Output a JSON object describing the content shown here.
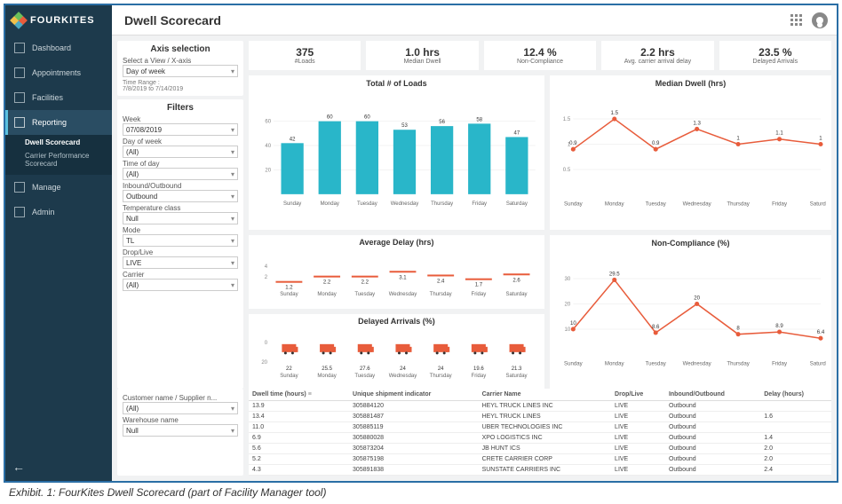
{
  "brand": "FOURKITES",
  "page_title": "Dwell Scorecard",
  "exhibit_caption": "Exhibit. 1: FourKites Dwell Scorecard (part of Facility Manager tool)",
  "sidebar": {
    "items": [
      {
        "label": "Dashboard",
        "active": false
      },
      {
        "label": "Appointments",
        "active": false
      },
      {
        "label": "Facilities",
        "active": false
      },
      {
        "label": "Reporting",
        "active": true
      },
      {
        "label": "Manage",
        "active": false
      },
      {
        "label": "Admin",
        "active": false
      }
    ],
    "sub_items": [
      {
        "label": "Dwell Scorecard",
        "selected": true
      },
      {
        "label": "Carrier Performance Scorecard",
        "selected": false
      }
    ],
    "collapse_icon": "←"
  },
  "axis": {
    "title": "Axis selection",
    "view_label": "Select a View / X-axis",
    "view_value": "Day of week",
    "time_range_label": "Time Range :",
    "time_range_value": "7/8/2019 to 7/14/2019"
  },
  "filters": {
    "title": "Filters",
    "fields": [
      {
        "label": "Week",
        "value": "07/08/2019"
      },
      {
        "label": "Day of week",
        "value": "(All)"
      },
      {
        "label": "Time of day",
        "value": "(All)"
      },
      {
        "label": "Inbound/Outbound",
        "value": "Outbound"
      },
      {
        "label": "Temperature class",
        "value": "Null"
      },
      {
        "label": "Mode",
        "value": "TL"
      },
      {
        "label": "Drop/Live",
        "value": "LIVE"
      },
      {
        "label": "Carrier",
        "value": "(All)"
      }
    ]
  },
  "table_filters": [
    {
      "label": "Customer name / Supplier n...",
      "value": "(All)"
    },
    {
      "label": "Warehouse name",
      "value": "Null"
    }
  ],
  "kpis": [
    {
      "value": "375",
      "label": "#Loads"
    },
    {
      "value": "1.0 hrs",
      "label": "Median Dwell"
    },
    {
      "value": "12.4 %",
      "label": "Non-Compliance"
    },
    {
      "value": "2.2 hrs",
      "label": "Avg. carrier arrival delay"
    },
    {
      "value": "23.5 %",
      "label": "Delayed Arrivals"
    }
  ],
  "chart_data": [
    {
      "id": "loads",
      "type": "bar",
      "title": "Total # of Loads",
      "categories": [
        "Sunday",
        "Monday",
        "Tuesday",
        "Wednesday",
        "Thursday",
        "Friday",
        "Saturday"
      ],
      "values": [
        42,
        60,
        60,
        53,
        56,
        58,
        47
      ],
      "ylim": [
        0,
        60
      ],
      "yticks": [
        20,
        40,
        60
      ],
      "color": "#29b6c9"
    },
    {
      "id": "median_dwell",
      "type": "line",
      "title": "Median Dwell (hrs)",
      "categories": [
        "Sunday",
        "Monday",
        "Tuesday",
        "Wednesday",
        "Thursday",
        "Friday",
        "Saturday"
      ],
      "values": [
        0.9,
        1.5,
        0.9,
        1.3,
        1.0,
        1.1,
        1.0
      ],
      "ylim": [
        0,
        1.5
      ],
      "yticks": [
        0.5,
        1.0,
        1.5
      ],
      "color": "#e85c3b"
    },
    {
      "id": "avg_delay",
      "type": "bar-thin",
      "title": "Average Delay (hrs)",
      "categories": [
        "Sunday",
        "Monday",
        "Tuesday",
        "Wednesday",
        "Thursday",
        "Friday",
        "Saturday"
      ],
      "values": [
        1.2,
        2.2,
        2.2,
        3.1,
        2.4,
        1.7,
        2.6
      ],
      "ylim": [
        0,
        4
      ],
      "yticks": [
        2,
        4
      ],
      "color": "#e85c3b"
    },
    {
      "id": "delayed_arrivals",
      "type": "icon-bar",
      "title": "Delayed Arrivals (%)",
      "categories": [
        "Sunday",
        "Monday",
        "Tuesday",
        "Wednesday",
        "Thursday",
        "Friday",
        "Saturday"
      ],
      "values": [
        22.0,
        25.5,
        27.6,
        24.0,
        24.0,
        19.6,
        21.3
      ],
      "ylim": [
        0,
        30
      ],
      "yticks": [
        20
      ],
      "color": "#e85c3b"
    },
    {
      "id": "non_compliance",
      "type": "line",
      "title": "Non-Compliance (%)",
      "categories": [
        "Sunday",
        "Monday",
        "Tuesday",
        "Wednesday",
        "Thursday",
        "Friday",
        "Saturday"
      ],
      "values": [
        10.0,
        29.5,
        8.6,
        20.0,
        8.0,
        8.9,
        6.4
      ],
      "ylim": [
        0,
        30
      ],
      "yticks": [
        10,
        20,
        30
      ],
      "color": "#e85c3b"
    }
  ],
  "table": {
    "columns": [
      "Dwell time (hours)",
      "Unique shipment indicator",
      "Carrier Name",
      "Drop/Live",
      "Inbound/Outbound",
      "Delay (hours)"
    ],
    "rows": [
      [
        "13.9",
        "305884120",
        "HEYL TRUCK LINES INC",
        "LIVE",
        "Outbound",
        ""
      ],
      [
        "13.4",
        "305881487",
        "HEYL TRUCK LINES",
        "LIVE",
        "Outbound",
        "1.6"
      ],
      [
        "11.0",
        "305885119",
        "UBER TECHNOLOGIES INC",
        "LIVE",
        "Outbound",
        ""
      ],
      [
        "6.9",
        "305880028",
        "XPO LOGISTICS INC",
        "LIVE",
        "Outbound",
        "1.4"
      ],
      [
        "5.6",
        "305873204",
        "JB HUNT ICS",
        "LIVE",
        "Outbound",
        "2.0"
      ],
      [
        "5.2",
        "305875198",
        "CRETE CARRIER CORP",
        "LIVE",
        "Outbound",
        "2.0"
      ],
      [
        "4.3",
        "305891838",
        "SUNSTATE CARRIERS INC",
        "LIVE",
        "Outbound",
        "2.4"
      ]
    ]
  }
}
